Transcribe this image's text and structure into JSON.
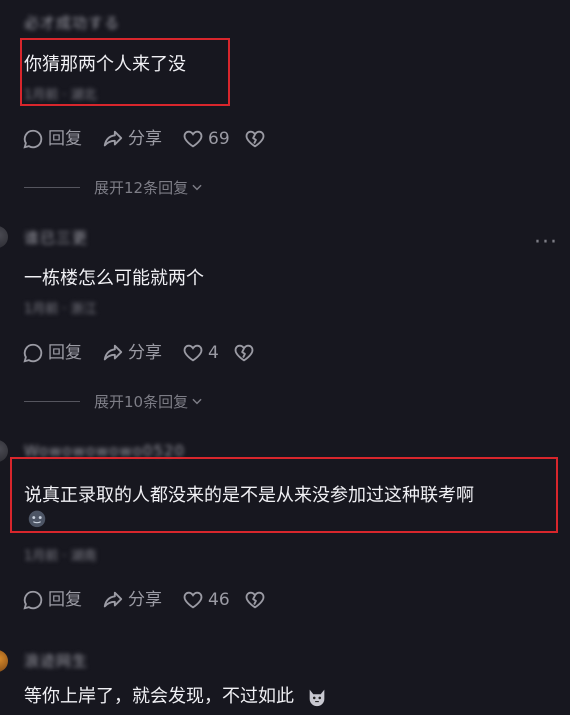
{
  "comments": [
    {
      "username": "必才成功する",
      "content": "你猜那两个人来了没",
      "meta": "1月前 · 湖北",
      "reply_label": "回复",
      "share_label": "分享",
      "likes": "69",
      "expand_label": "展开12条回复"
    },
    {
      "username": "谁已三更",
      "content": "一栋楼怎么可能就两个",
      "meta": "1月前 · 浙江",
      "reply_label": "回复",
      "share_label": "分享",
      "likes": "4",
      "expand_label": "展开10条回复",
      "more": "···"
    },
    {
      "username": "Wowowowowo0520",
      "content": "说真正录取的人都没来的是不是从来没参加过这种联考啊",
      "meta": "1月前 · 湖南",
      "reply_label": "回复",
      "share_label": "分享",
      "likes": "46"
    },
    {
      "username": "浪迹网生",
      "content": "等你上岸了，就会发现，不过如此"
    }
  ],
  "colors": {
    "background": "#17171f",
    "highlight_box": "#d8262c",
    "secondary_text": "#9b9ba4"
  }
}
